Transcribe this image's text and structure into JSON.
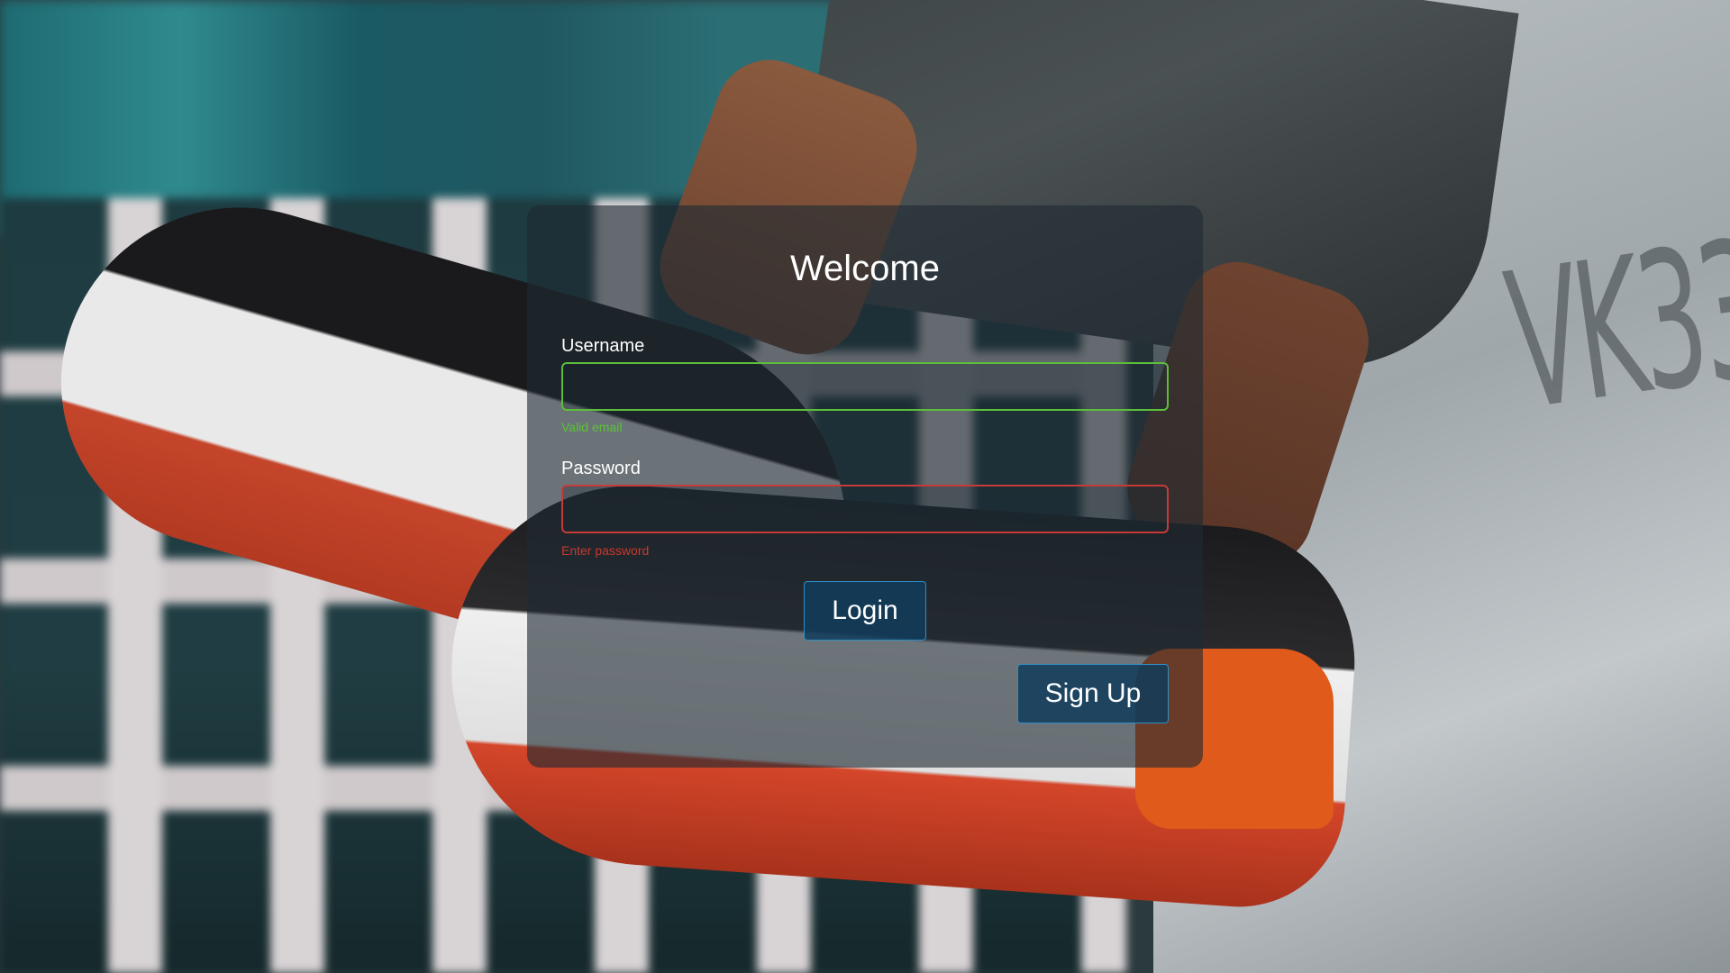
{
  "login_form": {
    "title": "Welcome",
    "username": {
      "label": "Username",
      "value": "",
      "hint": "Valid email",
      "state": "valid",
      "border_color": "#5bbf3a"
    },
    "password": {
      "label": "Password",
      "value": "",
      "hint": "Enter password",
      "state": "invalid",
      "border_color": "#c63a3a"
    },
    "login_label": "Login",
    "signup_label": "Sign Up"
  },
  "colors": {
    "card_background": "rgba(30,42,50,0.62)",
    "button_background": "#103c5c",
    "button_border": "#2f8fc7",
    "valid": "#5bc23a",
    "invalid": "#c8382f"
  }
}
